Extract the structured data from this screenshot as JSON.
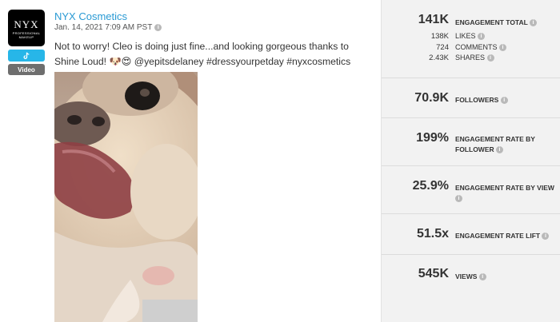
{
  "post": {
    "brand_logo": {
      "line1": "NYX",
      "line2": "PROFESSIONAL MAKEUP"
    },
    "platform_icon": "tiktok-icon",
    "media_type": "Video",
    "author": "NYX Cosmetics",
    "date": "Jan. 14, 2021 7:09 AM PST",
    "caption": "Not to worry! Cleo is doing just fine...and looking gorgeous thanks to Shine Loud! 🐶😍 @yepitsdelaney #dressyourpetday #nyxcosmetics"
  },
  "stats": {
    "engagement_total": {
      "value": "141K",
      "label": "ENGAGEMENT TOTAL"
    },
    "breakdown": [
      {
        "value": "138K",
        "label": "LIKES"
      },
      {
        "value": "724",
        "label": "COMMENTS"
      },
      {
        "value": "2.43K",
        "label": "SHARES"
      }
    ],
    "followers": {
      "value": "70.9K",
      "label": "FOLLOWERS"
    },
    "er_follower": {
      "value": "199%",
      "label": "ENGAGEMENT RATE BY FOLLOWER"
    },
    "er_view": {
      "value": "25.9%",
      "label": "ENGAGEMENT RATE BY VIEW"
    },
    "er_lift": {
      "value": "51.5x",
      "label": "ENGAGEMENT RATE LIFT"
    },
    "views": {
      "value": "545K",
      "label": "VIEWS"
    }
  },
  "colors": {
    "link": "#2a9ad4",
    "platform_badge": "#27b6e8",
    "panel_bg": "#f2f2f2"
  }
}
